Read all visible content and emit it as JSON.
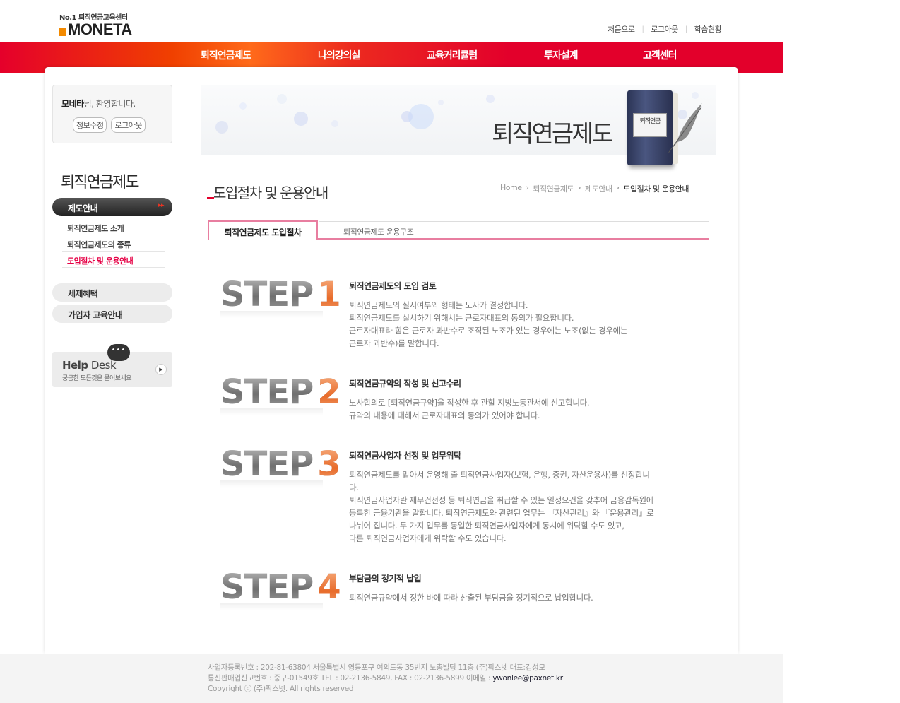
{
  "header": {
    "logo_tag": "No.1 퇴직연금교육센터",
    "logo_name": "MONETA",
    "links": [
      "처음으로",
      "로그아웃",
      "학습현황"
    ]
  },
  "nav": [
    "퇴직연금제도",
    "나의강의실",
    "교육커리큘럼",
    "투자설계",
    "고객센터"
  ],
  "login": {
    "user": "모네타",
    "greeting": "님, 환영합니다.",
    "edit_button": "정보수정",
    "logout_button": "로그아웃"
  },
  "sidebar": {
    "title": "퇴직연금제도",
    "active": "제도안내",
    "sub": [
      "퇴직연금제도 소개",
      "퇴직연금제도의 종류",
      "도입절차 및 운용안내"
    ],
    "menus": [
      "세제혜택",
      "가입자 교육안내"
    ],
    "help_title_bold": "Help",
    "help_title_rest": " Desk",
    "help_sub": "궁금한 모든것을 물어보세요"
  },
  "banner": {
    "title": "퇴직연금제도",
    "book_label": "퇴직연금"
  },
  "page": {
    "title": "도입절차 및 운용안내",
    "breadcrumb": [
      "Home",
      "퇴직연금제도",
      "제도안내",
      "도입절차 및 운용안내"
    ]
  },
  "tabs": [
    "퇴직연금제도 도입절차",
    "퇴직연금제도 운용구조"
  ],
  "steps": [
    {
      "label": "STEP",
      "number": "1",
      "title": "퇴직연금제도의 도입 검토",
      "lines": [
        "퇴직연금제도의 실시여부와 형태는 노사가 결정합니다.",
        "퇴직연금제도를 실시하기 위해서는 근로자대표의 동의가 필요합니다.",
        "근로자대표라 함은 근로자 과반수로 조직된 노조가 있는 경우에는 노조(없는 경우에는",
        "근로자 과반수)를 말합니다."
      ]
    },
    {
      "label": "STEP",
      "number": "2",
      "title": "퇴직연금규약의 작성 및 신고수리",
      "lines": [
        "노사합의로 [퇴직연금규약]을 작성한 후 관할 지방노동관서에 신고합니다.",
        "규약의 내용에 대해서 근로자대표의 동의가 있어야 합니다."
      ]
    },
    {
      "label": "STEP",
      "number": "3",
      "title": "퇴직연금사업자 선정 및 업무위탁",
      "lines": [
        "퇴직연금제도를 맡아서 운영해 줄 퇴직연금사업자(보험, 은행, 증권, 자산운용사)를 선정합니",
        "다.",
        "퇴직연금사업자란 재무건전성 등 퇴직연금을 취급할 수 있는 일정요건을 갖추어 금융감독원에",
        "등록한 금융기관을 말합니다. 퇴직연금제도와 관련된 업무는 『자산관리』와 『운용관리』로",
        "나뉘어 집니다. 두 가지 업무를 동일한 퇴직연금사업자에게 동시에 위탁할 수도 있고,",
        "다른 퇴직연금사업자에게 위탁할 수도 있습니다."
      ]
    },
    {
      "label": "STEP",
      "number": "4",
      "title": "부담금의 정기적 납입",
      "lines": [
        "퇴직연금규약에서 정한 바에 따라 산출된 부담금을 정기적으로 납입합니다."
      ]
    }
  ],
  "footer": {
    "line1": "사업자등록번호 : 202-81-63804 서울특별시 영등포구 여의도동 35번지 노총빌딩 11층 (주)팍스넷 대표:김성모",
    "line2": "통신판매업신고번호 : 중구-01549호 TEL : 02-2136-5849, FAX : 02-2136-5899 이메일 : ",
    "email": "ywonlee@paxnet.kr",
    "line3": "Copyright ⓒ (주)팍스넷. All rights reserved"
  }
}
